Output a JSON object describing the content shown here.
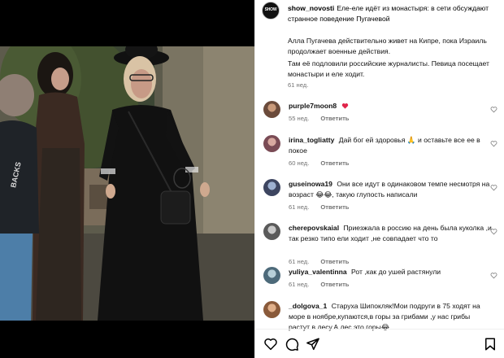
{
  "post": {
    "username": "show_novosti",
    "avatar_text": "SHOW",
    "caption_title": "Еле-еле идёт из монастыря: в сети обсуждают странное поведение Пугачевой",
    "caption_p1": "Алла Пугачева действительно живет на Кипре, пока Израиль продолжает военные действия.",
    "caption_p2": "Там её подловили российские журналисты. Певица посещает монастыри и еле ходит.",
    "time": "61 нед."
  },
  "reply_label": "Ответить",
  "comments": [
    {
      "username": "purple7moon8",
      "text": "",
      "emoji": "heart",
      "time": "55 нед.",
      "avatar_color": "#6b4b3b"
    },
    {
      "username": "irina_togliatty",
      "text": "Дай бог ей здоровья 🙏 и оставьте все ее в покое",
      "time": "60 нед.",
      "avatar_color": "#7a4b55"
    },
    {
      "username": "guseinowa19",
      "text": "Они все идут в одинаковом темпе несмотря на возраст 😂😂, такую глупость написали",
      "time": "61 нед.",
      "avatar_color": "#3d4560"
    },
    {
      "username": "cherepovskaial",
      "text": "Приезжала в россию на день была куколка ,и так резко типо ели ходит ,не совпадает что то",
      "time": "61 нед.",
      "avatar_color": "#5a5a5a"
    },
    {
      "username": "yuliya_valentinna",
      "text": "Рот ,как до ушей растянули",
      "time": "61 нед.",
      "avatar_color": "#4d6a7a"
    },
    {
      "username": "_dolgova_1",
      "text": "Старуха Шипокляк!Мои подруги в 75 ходят на море в ноябре,купаются,в горы за грибами ,у нас грибы растут в лесу.А лес это горы😂",
      "time": "",
      "avatar_color": "#8a5a3a"
    }
  ],
  "footer_icons": [
    "heart-icon",
    "comment-icon",
    "share-icon",
    "bookmark-icon"
  ],
  "video_text": "BACKS"
}
